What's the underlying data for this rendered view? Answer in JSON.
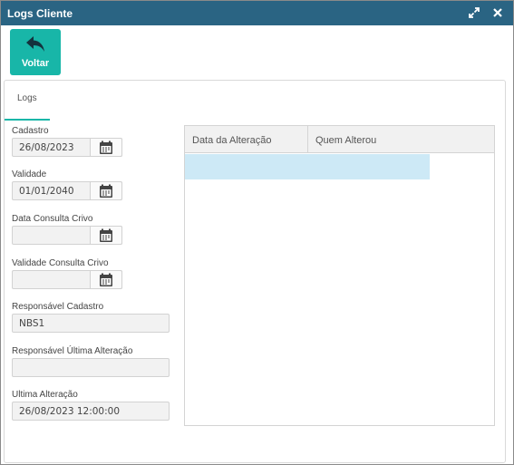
{
  "window": {
    "title": "Logs Cliente"
  },
  "toolbar": {
    "back_label": "Voltar"
  },
  "tabs": [
    {
      "label": "Logs"
    }
  ],
  "form": {
    "cadastro": {
      "label": "Cadastro",
      "value": "26/08/2023"
    },
    "validade": {
      "label": "Validade",
      "value": "01/01/2040"
    },
    "data_consulta_crivo": {
      "label": "Data Consulta Crivo",
      "value": ""
    },
    "validade_consulta_crivo": {
      "label": "Validade Consulta Crivo",
      "value": ""
    },
    "responsavel_cadastro": {
      "label": "Responsável Cadastro",
      "value": "NBS1"
    },
    "responsavel_ultima_alteracao": {
      "label": "Responsável Última Alteração",
      "value": ""
    },
    "ultima_alteracao": {
      "label": "Ultima Alteração",
      "value": "26/08/2023 12:00:00"
    }
  },
  "grid": {
    "columns": [
      "Data da Alteração",
      "Quem Alterou"
    ],
    "rows": [
      [
        "",
        ""
      ]
    ]
  },
  "colors": {
    "titlebar": "#2a6483",
    "accent": "#18b6a8",
    "selected_row": "#cde9f6"
  }
}
